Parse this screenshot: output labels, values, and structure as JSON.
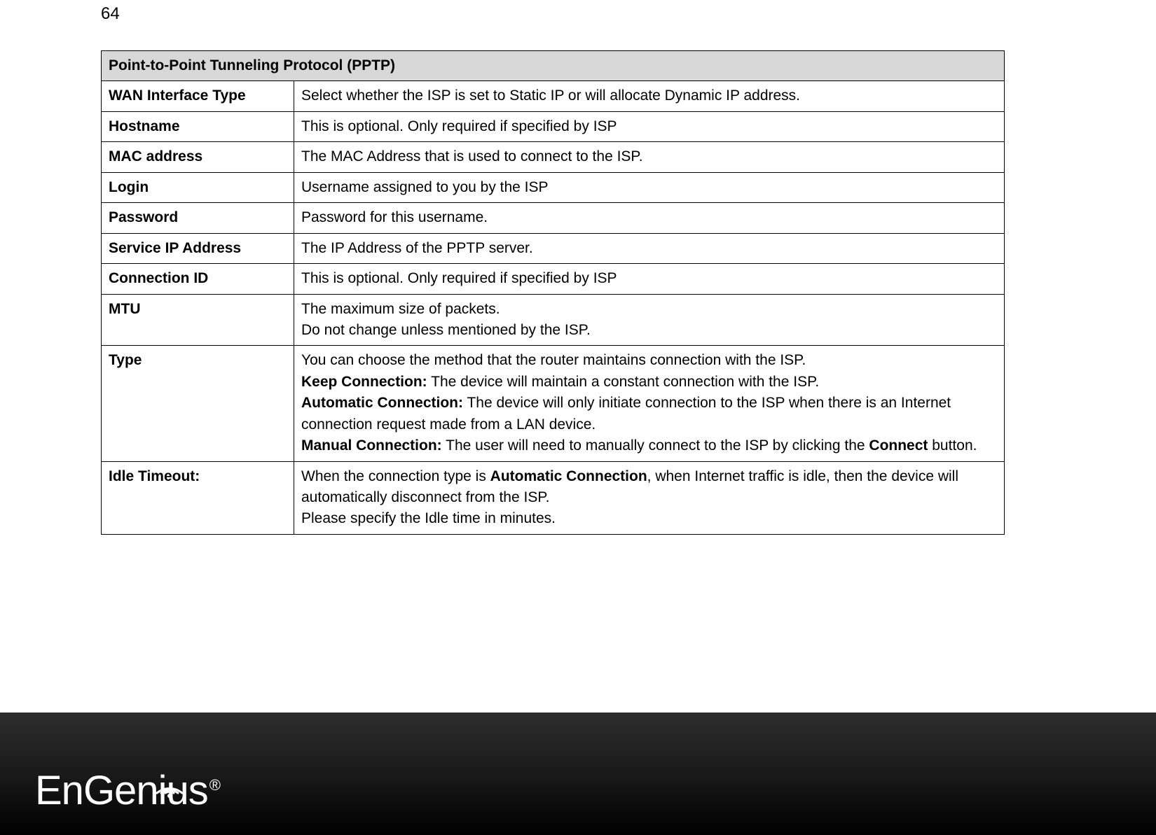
{
  "page_number": "64",
  "table": {
    "header": "Point-to-Point Tunneling Protocol (PPTP)",
    "rows": [
      {
        "label": "WAN Interface Type",
        "text": "Select whether the ISP is set to Static IP or will allocate Dynamic IP address."
      },
      {
        "label": "Hostname",
        "text": "This is optional. Only required if specified by ISP"
      },
      {
        "label": "MAC address",
        "text": "The MAC Address that is used to connect to the ISP."
      },
      {
        "label": "Login",
        "text": "Username assigned to you by the ISP"
      },
      {
        "label": "Password",
        "text": "Password for this username."
      },
      {
        "label": "Service IP Address",
        "text": "The IP Address of the PPTP server."
      },
      {
        "label": "Connection ID",
        "text": "This is optional. Only required if specified by ISP"
      },
      {
        "label": "MTU",
        "lines": [
          "The maximum size of packets.",
          "Do not change unless mentioned by the ISP."
        ]
      },
      {
        "label": "Type",
        "type_block": {
          "intro": "You can choose the method that the router maintains connection with the ISP.",
          "keep_label": "Keep Connection:",
          "keep_text": " The device will maintain a constant connection with the ISP.",
          "auto_label": "Automatic Connection:",
          "auto_text": " The device will only initiate connection to the ISP when there is an Internet connection request made from a LAN device.",
          "manual_label": "Manual Connection:",
          "manual_text_a": " The user will need to manually connect to the ISP by clicking the ",
          "manual_bold": "Connect",
          "manual_text_b": " button."
        }
      },
      {
        "label": "Idle Timeout:",
        "idle_block": {
          "a": "When the connection type is ",
          "bold": "Automatic Connection",
          "b": ", when Internet traffic is idle, then the device will automatically disconnect from the ISP.",
          "c": "Please specify the Idle time in minutes."
        }
      }
    ]
  },
  "footer": {
    "brand": "EnGenius",
    "reg": "®"
  }
}
